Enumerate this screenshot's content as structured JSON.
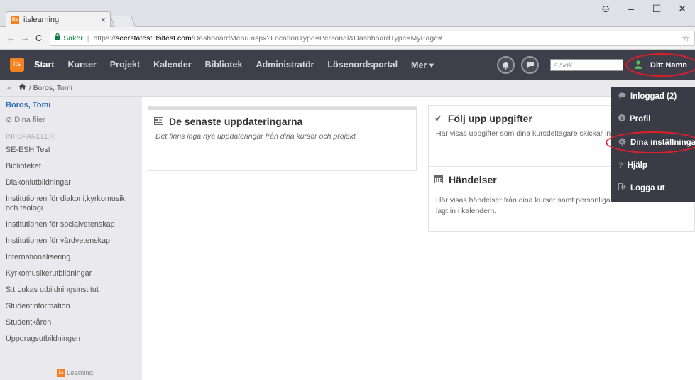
{
  "browser": {
    "tab_title": "itslearning",
    "tab_close": "×",
    "favicon_text": "its",
    "window_controls": [
      "⊖",
      "–",
      "☐",
      "✕"
    ],
    "back": "←",
    "forward": "→",
    "reload": "C",
    "secure_label": "Säker",
    "url_scheme": "https://",
    "url_host": "seerstatest.itsltest.com",
    "url_path": "/DashboardMenu.aspx?LocationType=Personal&DashboardType=MyPage#",
    "bookmark_star": "☆"
  },
  "appbar": {
    "logo_text": "its",
    "nav": [
      {
        "label": "Start"
      },
      {
        "label": "Kurser"
      },
      {
        "label": "Projekt"
      },
      {
        "label": "Kalender"
      },
      {
        "label": "Bibliotek"
      },
      {
        "label": "Administratör"
      },
      {
        "label": "Lösenordsportal"
      },
      {
        "label": "Mer ▾"
      }
    ],
    "search_placeholder": "Sök",
    "user_name": "Ditt Namn",
    "accent_color": "#f58220",
    "bar_color": "#3e3f4a",
    "highlight_color": "#e01e2b"
  },
  "breadcrumb": {
    "collapse": "«",
    "text": "/ Boros, Tomi"
  },
  "sidebar": {
    "user_name": "Boros, Tomi",
    "files_label": "Dina filer",
    "section_heading": "INFOPANELER",
    "items": [
      "SE-ESH Test",
      "Biblioteket",
      "Diakoniutbildningar",
      "Institutionen för diakoni,kyrkomusik och teologi",
      "Institutionen för socialvetenskap",
      "Institutionen för vårdvetenskap",
      "Internationalisering",
      "Kyrkomusikerutbildningar",
      "S:t Lukas utbildningsinstitut",
      "Studentinformation",
      "Studentkåren",
      "Uppdragsutbildningen"
    ],
    "footer_logo_text": "Learning"
  },
  "main": {
    "updates": {
      "title": "De senaste uppdateringarna",
      "text": "Det finns inga nya uppdateringar från dina kurser och projekt"
    },
    "tasks": {
      "title": "Följ upp uppgifter",
      "text": "Här visas uppgifter som dina kursdeltagare skickar in."
    },
    "events": {
      "title": "Händelser",
      "text": "Här visas händelser från dina kurser samt personliga händelser som du har lagt in i kalendern."
    }
  },
  "dropdown": {
    "items": [
      {
        "label": "Inloggad (2)",
        "icon": "chat-icon"
      },
      {
        "label": "Profil",
        "icon": "info-icon"
      },
      {
        "label": "Dina inställningar",
        "icon": "gear-icon"
      },
      {
        "label": "Hjälp",
        "icon": "question-icon"
      },
      {
        "label": "Logga ut",
        "icon": "logout-icon"
      }
    ]
  }
}
